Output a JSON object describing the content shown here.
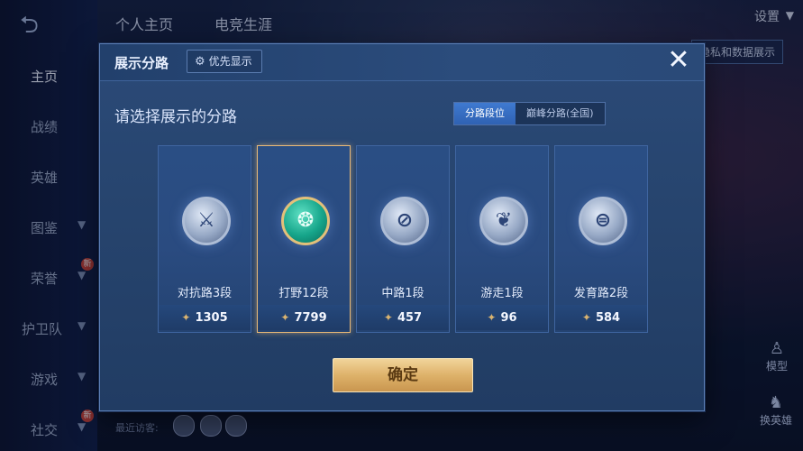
{
  "sidebar": {
    "items": [
      {
        "label": "主页",
        "chevron": false,
        "badge": ""
      },
      {
        "label": "战绩",
        "chevron": false,
        "badge": ""
      },
      {
        "label": "英雄",
        "chevron": false,
        "badge": ""
      },
      {
        "label": "图鉴",
        "chevron": true,
        "badge": ""
      },
      {
        "label": "荣誉",
        "chevron": true,
        "badge": "新"
      },
      {
        "label": "护卫队",
        "chevron": true,
        "badge": ""
      },
      {
        "label": "游戏",
        "chevron": true,
        "badge": ""
      },
      {
        "label": "社交",
        "chevron": true,
        "badge": "新"
      }
    ]
  },
  "header": {
    "tabs": [
      "个人主页",
      "电竞生涯"
    ],
    "settings": "设置",
    "right_tag": "隐私和数据展示"
  },
  "footer": {
    "recent_visitors": "最近访客:",
    "model": "模型",
    "swap_hero": "换英雄"
  },
  "modal": {
    "title": "展示分路",
    "priority_label": "优先显示",
    "subtitle": "请选择展示的分路",
    "segments": [
      "分路段位",
      "巅峰分路(全国)"
    ],
    "active_segment": 0,
    "confirm_label": "确定"
  },
  "lanes": [
    {
      "rank": "对抗路3段",
      "points": "1305",
      "selected": false,
      "icon": "clash-lane-emblem-icon"
    },
    {
      "rank": "打野12段",
      "points": "7799",
      "selected": true,
      "icon": "jungle-emblem-icon"
    },
    {
      "rank": "中路1段",
      "points": "457",
      "selected": false,
      "icon": "mid-lane-emblem-icon"
    },
    {
      "rank": "游走1段",
      "points": "96",
      "selected": false,
      "icon": "roam-emblem-icon"
    },
    {
      "rank": "发育路2段",
      "points": "584",
      "selected": false,
      "icon": "farm-lane-emblem-icon"
    }
  ],
  "colors": {
    "accent": "#3f7ad0",
    "gold": "#deb26a",
    "modal_bg": "#27456f"
  }
}
